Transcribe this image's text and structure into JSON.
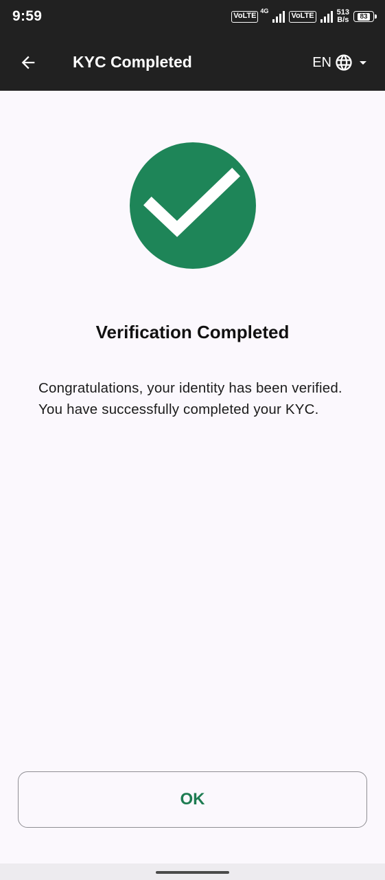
{
  "status_bar": {
    "time": "9:59",
    "sim1_label": "VoLTE",
    "sim1_network": "4G",
    "sim2_label": "VoLTE",
    "speed_value": "513",
    "speed_unit": "B/s",
    "battery_level": "83"
  },
  "app_bar": {
    "back_icon": "arrow-left-icon",
    "title": "KYC Completed",
    "language_code": "EN",
    "globe_icon": "globe-icon",
    "dropdown_icon": "caret-down-icon"
  },
  "content": {
    "badge_icon": "check-circle-icon",
    "heading": "Verification Completed",
    "message": "Congratulations, your identity has been verified. You have successfully completed your KYC."
  },
  "actions": {
    "ok_label": "OK"
  },
  "colors": {
    "bar_background": "#212121",
    "page_background": "#FBF8FD",
    "success_green": "#1E8558",
    "button_text": "#1E7C52",
    "button_border": "#8E8E93"
  }
}
